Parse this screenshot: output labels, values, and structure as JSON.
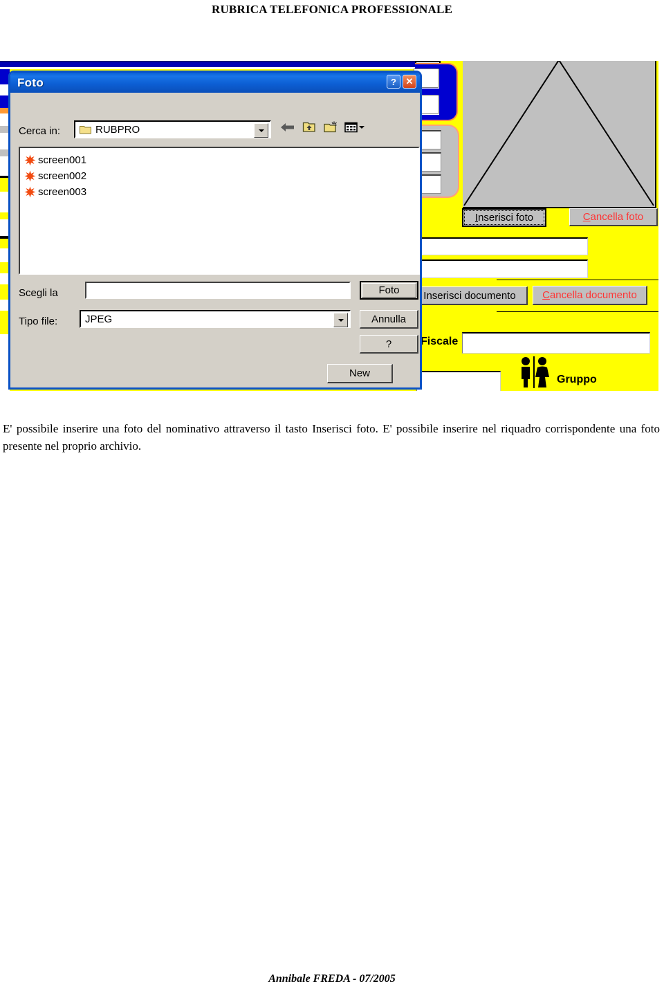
{
  "document": {
    "title": "RUBRICA TELEFONICA PROFESSIONALE",
    "body_text": "E' possibile inserire una foto del nominativo attraverso il tasto Inserisci foto. E' possibile inserire nel riquadro corrispondente una foto presente nel proprio archivio.",
    "footer": "Annibale FREDA - 07/2005"
  },
  "dialog": {
    "title": "Foto",
    "help_button": "?",
    "close_button": "✕",
    "look_in_label": "Cerca in:",
    "look_in_value": "RUBPRO",
    "files": [
      {
        "name": "screen001",
        "icon": "starburst-icon"
      },
      {
        "name": "screen002",
        "icon": "starburst-icon"
      },
      {
        "name": "screen003",
        "icon": "starburst-icon"
      }
    ],
    "file_name_label": "Scegli la",
    "file_name_value": "",
    "file_type_label": "Tipo file:",
    "file_type_value": "JPEG",
    "buttons": {
      "open": "Foto",
      "cancel": "Annulla",
      "help": "?",
      "new": "New"
    },
    "toolbar_icons": [
      "back-arrow-icon",
      "up-one-level-icon",
      "new-folder-icon",
      "view-menu-icon"
    ]
  },
  "background_app": {
    "insert_photo_button": "Inserisci foto",
    "delete_photo_button": "Cancella foto",
    "insert_document_button": "Inserisci documento",
    "delete_document_button": "Cancella documento",
    "fiscale_label": "Fiscale",
    "fiscale_value": "",
    "gruppo_label": "Gruppo",
    "gruppo_value": ""
  },
  "colors": {
    "app_background": "#ffff00",
    "dialog_face": "#d4d0c8",
    "title_blue": "#0a52c6",
    "delete_red": "#ff3333",
    "panel_blue": "#0000d0",
    "panel_gray": "#c0c0c0"
  }
}
